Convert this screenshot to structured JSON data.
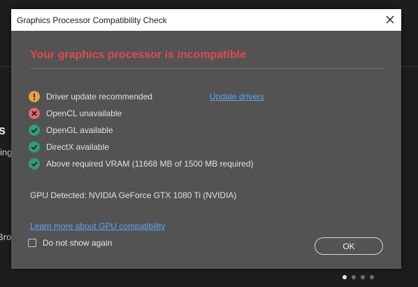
{
  "background": {
    "fragments": [
      "s",
      "ing",
      "Bro"
    ],
    "page_indicator": {
      "count": 4,
      "active_index": 0
    }
  },
  "dialog": {
    "title": "Graphics Processor Compatibility Check",
    "close_icon": "close-icon",
    "heading": "Your graphics processor is incompatible",
    "heading_color": "#e34850",
    "status_items": [
      {
        "icon": "warning-icon",
        "label": "Driver update recommended",
        "color": "#e8a33a"
      },
      {
        "icon": "error-icon",
        "label": "OpenCL unavailable",
        "color": "#e06a6f"
      },
      {
        "icon": "check-icon",
        "label": "OpenGL available",
        "color": "#2fa071"
      },
      {
        "icon": "check-icon",
        "label": "DirectX available",
        "color": "#2fa071"
      },
      {
        "icon": "check-icon",
        "label": "Above required VRAM (11668 MB of 1500 MB required)",
        "color": "#2fa071"
      }
    ],
    "update_link": "Update drivers",
    "gpu_detected": "GPU Detected: NVIDIA GeForce GTX 1080 Ti (NVIDIA)",
    "learn_more_link": "Learn more about GPU compatibility",
    "do_not_show_label": "Do not show again",
    "do_not_show_checked": false,
    "ok_label": "OK",
    "link_color": "#5ea3f2"
  }
}
